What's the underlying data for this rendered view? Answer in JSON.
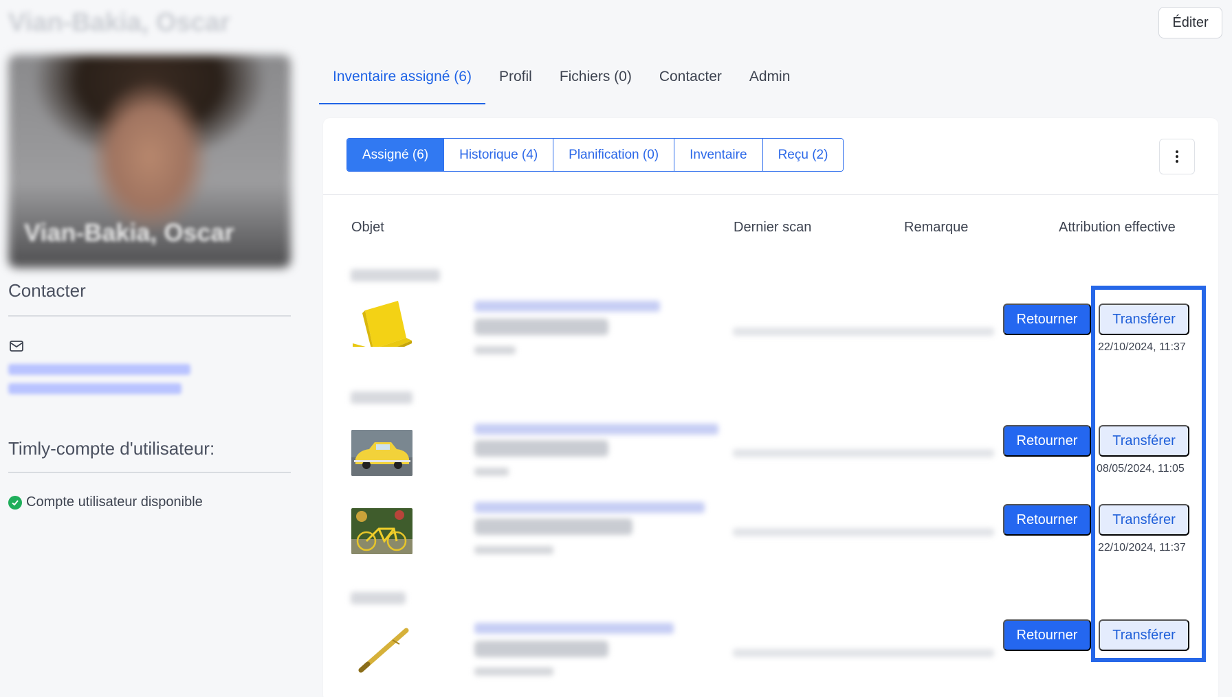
{
  "header": {
    "user_name": "Vian-Bakia, Oscar",
    "edit_label": "Éditer"
  },
  "sidebar": {
    "avatar_caption": "Vian-Bakia, Oscar",
    "contact_heading": "Contacter",
    "account_heading": "Timly-compte d'utilisateur:",
    "account_status": "Compte utilisateur disponible"
  },
  "tabs": [
    {
      "label": "Inventaire assigné (6)",
      "active": true
    },
    {
      "label": "Profil"
    },
    {
      "label": "Fichiers (0)"
    },
    {
      "label": "Contacter"
    },
    {
      "label": "Admin"
    }
  ],
  "segments": [
    {
      "label": "Assigné (6)",
      "active": true
    },
    {
      "label": "Historique (4)"
    },
    {
      "label": "Planification (0)"
    },
    {
      "label": "Inventaire"
    },
    {
      "label": "Reçu (2)"
    }
  ],
  "table": {
    "headers": {
      "object": "Objet",
      "last_scan": "Dernier scan",
      "remark": "Remarque",
      "effective": "Attribution effective"
    },
    "return_label": "Retourner",
    "transfer_label": "Transférer",
    "rows": [
      {
        "thumb": "laptop",
        "date": "22/10/2024, 11:37"
      },
      {
        "thumb": "car",
        "date": "08/05/2024, 11:05"
      },
      {
        "thumb": "bike",
        "date": "22/10/2024, 11:37"
      },
      {
        "thumb": "pen",
        "date": ""
      }
    ]
  },
  "colors": {
    "accent": "#2467f0",
    "transfer_bg": "#e4ecfd",
    "highlight": "#2667e8",
    "success": "#1fae5b"
  }
}
